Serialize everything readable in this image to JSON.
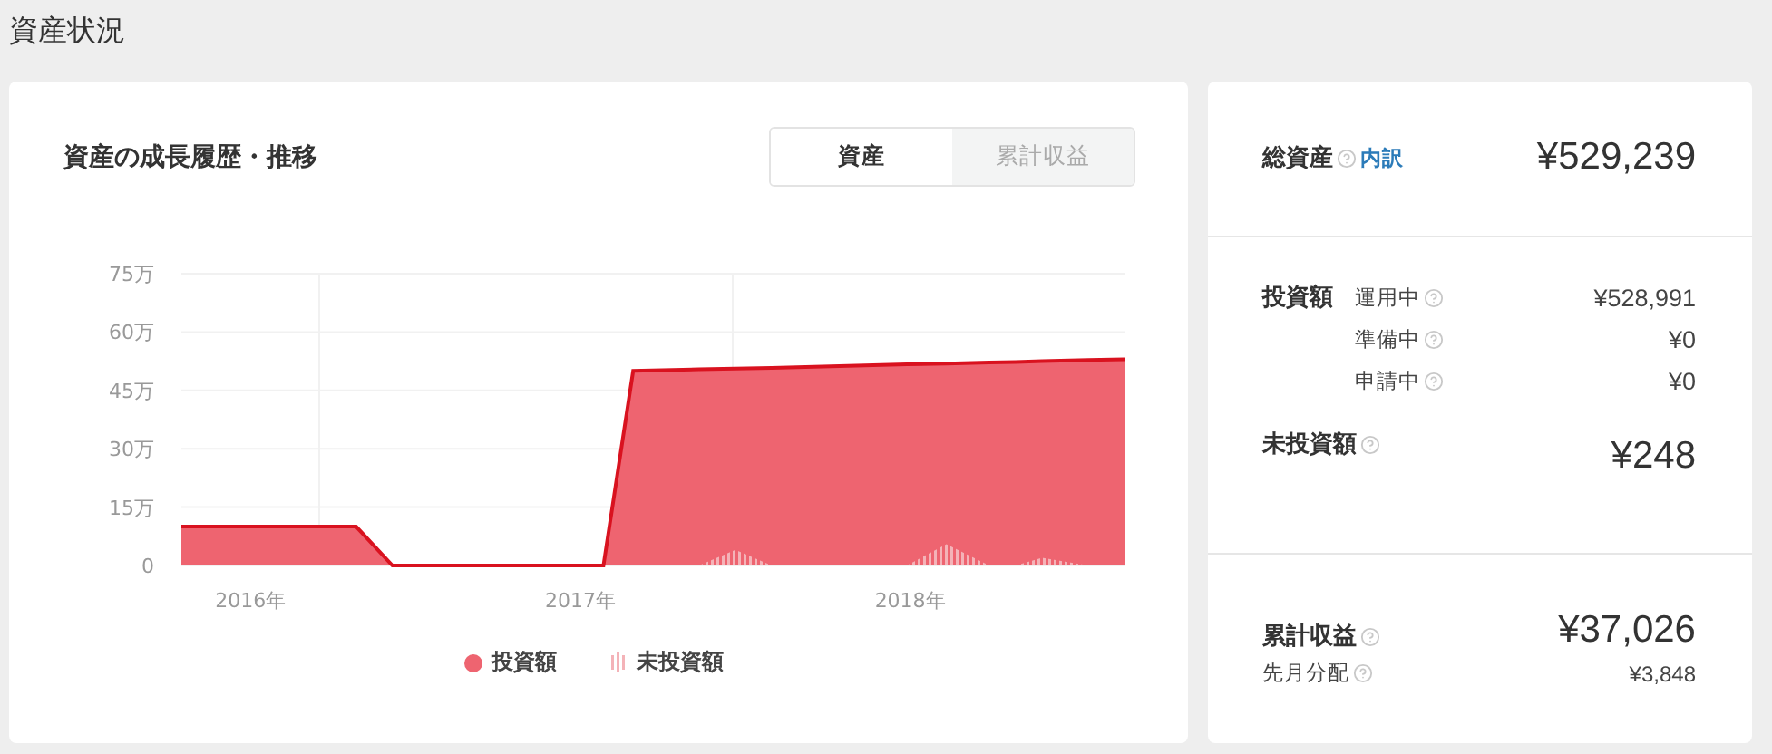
{
  "page_title": "資産状況",
  "growth_card": {
    "title": "資産の成長履歴・推移",
    "tabs": [
      {
        "label": "資産",
        "selected": true
      },
      {
        "label": "累計収益",
        "selected": false
      }
    ],
    "chart_data": {
      "type": "area",
      "grid": true,
      "x": [
        2015.79,
        2016.32,
        2016.43,
        2017.07,
        2017.16,
        2017.36,
        2017.47,
        2017.58,
        2017.99,
        2018.11,
        2018.24,
        2018.32,
        2018.4,
        2018.54,
        2018.65
      ],
      "xticks": [
        {
          "value": 2016,
          "label": "2016年"
        },
        {
          "value": 2017,
          "label": "2017年"
        },
        {
          "value": 2018,
          "label": "2018年"
        }
      ],
      "xlim": [
        2015.79,
        2018.65
      ],
      "ylim": [
        0,
        75
      ],
      "yticks": [
        {
          "value": 0,
          "label": "0"
        },
        {
          "value": 15,
          "label": "15万"
        },
        {
          "value": 30,
          "label": "30万"
        },
        {
          "value": 45,
          "label": "45万"
        },
        {
          "value": 60,
          "label": "60万"
        },
        {
          "value": 75,
          "label": "75万"
        }
      ],
      "series": [
        {
          "name": "投資額",
          "color": "#ee6470",
          "values": [
            10,
            10,
            0,
            0,
            50,
            50.4,
            50.6,
            50.8,
            51.7,
            51.9,
            52.2,
            52.3,
            52.5,
            52.8,
            53
          ]
        },
        {
          "name": "未投資額",
          "color": "#f4b3b8",
          "values": [
            0,
            0,
            0,
            0,
            0,
            0,
            4,
            0,
            0,
            5.5,
            0,
            0,
            2,
            0,
            0
          ]
        }
      ]
    }
  },
  "summary": {
    "total": {
      "label": "総資産",
      "link": "内訳",
      "value": "¥529,239"
    },
    "investment": {
      "label": "投資額",
      "items": [
        {
          "label": "運用中",
          "value": "¥528,991"
        },
        {
          "label": "準備中",
          "value": "¥0"
        },
        {
          "label": "申請中",
          "value": "¥0"
        }
      ]
    },
    "uninvested": {
      "label": "未投資額",
      "value": "¥248"
    },
    "returns": {
      "label": "累計収益",
      "value": "¥37,026",
      "sub": {
        "label": "先月分配",
        "value": "¥3,848"
      }
    }
  }
}
